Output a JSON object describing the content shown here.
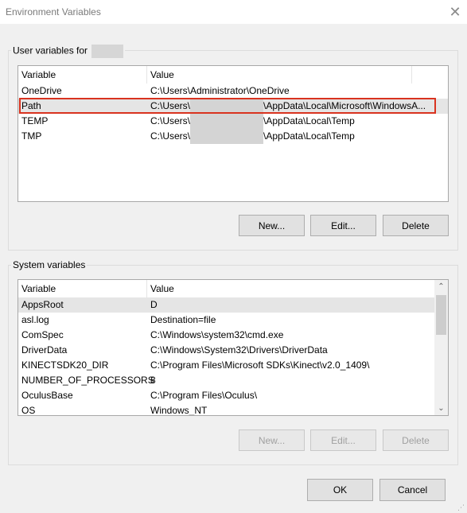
{
  "window": {
    "title": "Environment Variables",
    "close_symbol": "✕"
  },
  "user_vars": {
    "label": "User variables for",
    "columns": {
      "variable": "Variable",
      "value": "Value"
    },
    "rows": [
      {
        "name": "OneDrive",
        "value": "C:\\Users\\Administrator\\OneDrive"
      },
      {
        "name": "Path",
        "value_prefix": "C:\\Users\\",
        "value_suffix": "\\AppData\\Local\\Microsoft\\WindowsA..."
      },
      {
        "name": "TEMP",
        "value_prefix": "C:\\Users\\",
        "value_suffix": "\\AppData\\Local\\Temp"
      },
      {
        "name": "TMP",
        "value_prefix": "C:\\Users\\",
        "value_suffix": "\\AppData\\Local\\Temp"
      }
    ],
    "buttons": {
      "new": "New...",
      "edit": "Edit...",
      "delete": "Delete"
    }
  },
  "system_vars": {
    "label": "System variables",
    "columns": {
      "variable": "Variable",
      "value": "Value"
    },
    "rows": [
      {
        "name": "AppsRoot",
        "value": "D"
      },
      {
        "name": "asl.log",
        "value": "Destination=file"
      },
      {
        "name": "ComSpec",
        "value": "C:\\Windows\\system32\\cmd.exe"
      },
      {
        "name": "DriverData",
        "value": "C:\\Windows\\System32\\Drivers\\DriverData"
      },
      {
        "name": "KINECTSDK20_DIR",
        "value": "C:\\Program Files\\Microsoft SDKs\\Kinect\\v2.0_1409\\"
      },
      {
        "name": "NUMBER_OF_PROCESSORS",
        "value": "8"
      },
      {
        "name": "OculusBase",
        "value": "C:\\Program Files\\Oculus\\"
      },
      {
        "name": "OS",
        "value": "Windows_NT"
      }
    ],
    "buttons": {
      "new": "New...",
      "edit": "Edit...",
      "delete": "Delete"
    },
    "scroll_up": "⌃",
    "scroll_down": "⌄"
  },
  "footer": {
    "ok": "OK",
    "cancel": "Cancel"
  },
  "colors": {
    "highlight": "#d9331f",
    "selected_row": "#e5e5e5"
  },
  "icons": {
    "close": "close-icon",
    "resize": "resize-grip-icon"
  }
}
